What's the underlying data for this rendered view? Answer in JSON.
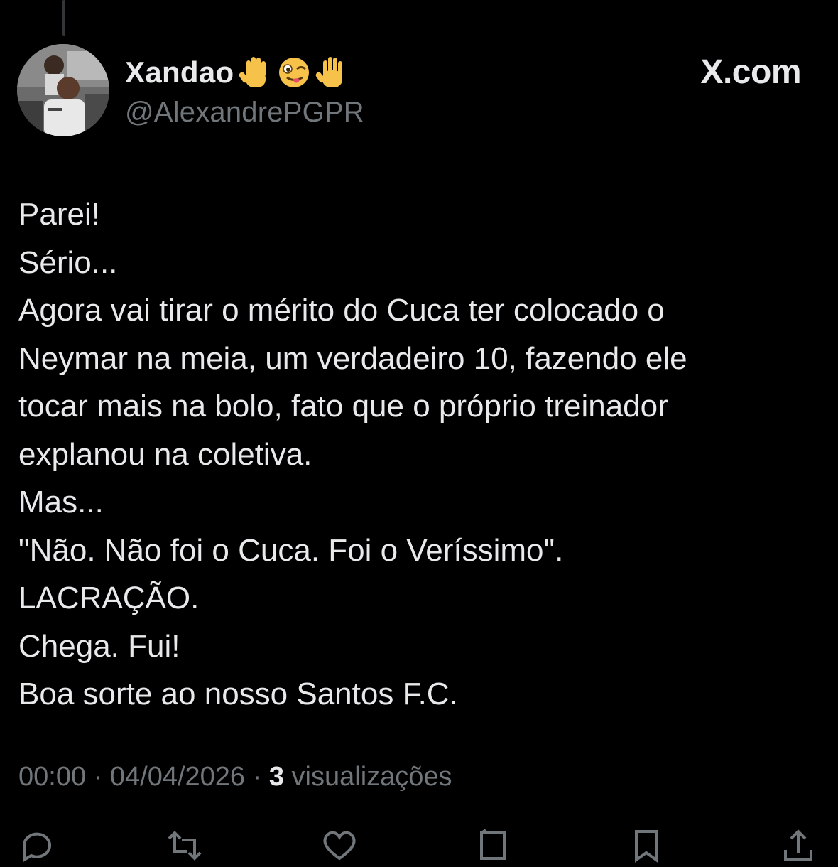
{
  "author": {
    "display_name": "Xandao",
    "handle": "@AlexandrePGPR",
    "name_emojis": [
      "raised-hand-emoji",
      "winking-face-with-tongue-emoji",
      "raised-hand-emoji"
    ]
  },
  "brand": {
    "label": "X.com"
  },
  "tweet": {
    "lines": [
      "Parei!",
      "Sério...",
      "Agora vai tirar o mérito do Cuca ter colocado o",
      "Neymar na meia, um verdadeiro 10, fazendo ele",
      "tocar mais na bolo, fato que o próprio treinador",
      "explanou na coletiva.",
      "Mas...",
      "\"Não. Não foi o Cuca. Foi o Veríssimo\".",
      "LACRAÇÃO.",
      "Chega. Fui!",
      "Boa sorte ao nosso Santos F.C."
    ]
  },
  "meta": {
    "time": "00:00",
    "date": "04/04/2026",
    "separator": "·",
    "views_count": "3",
    "views_label": "visualizações"
  },
  "actions": [
    "reply-icon",
    "retweet-icon",
    "like-icon",
    "views-icon",
    "bookmark-icon",
    "share-icon"
  ],
  "colors": {
    "background": "#000000",
    "text": "#e7e9ea",
    "secondary": "#71767b",
    "emoji_yellow": "#f7c24a"
  }
}
